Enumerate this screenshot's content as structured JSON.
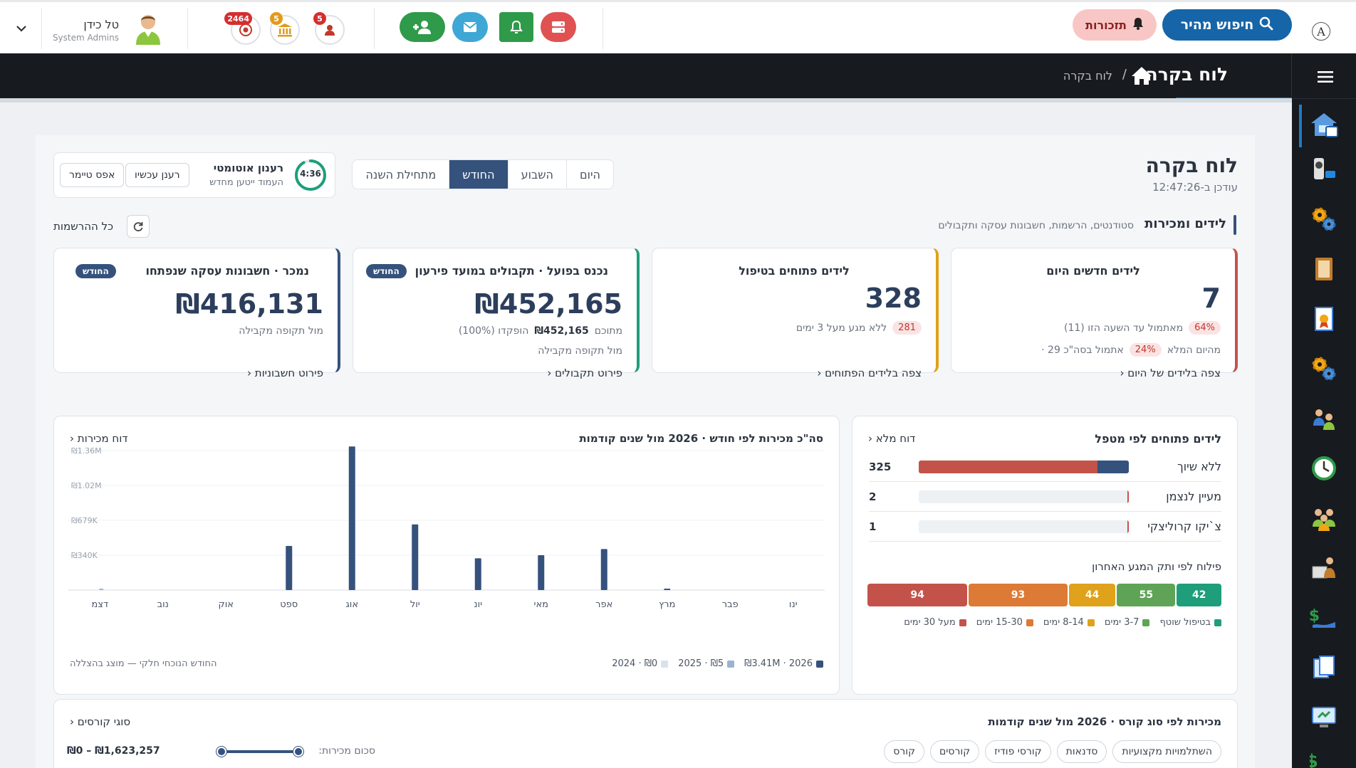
{
  "topbar": {
    "user_name": "טל כידן",
    "user_role": "System Admins",
    "badges": [
      "2464",
      "5",
      "5"
    ],
    "reminders_label": "תזכורות",
    "search_label": "חיפוש מהיר",
    "accessibility_glyph": "A"
  },
  "header": {
    "title": "לוח בקרה",
    "breadcrumb_sep": "/",
    "breadcrumb_current": "לוח בקרה"
  },
  "dashboard": {
    "title": "לוח בקרה",
    "updated": "עודכן ב-12:47:26",
    "tabs": [
      {
        "label": "היום"
      },
      {
        "label": "השבוע"
      },
      {
        "label": "החודש",
        "active": true
      },
      {
        "label": "מתחילת השנה"
      }
    ],
    "auto_refresh_title": "רענון אוטומטי",
    "auto_refresh_sub": "העמוד ייטען מחדש",
    "timer": "4:36",
    "timer_fraction": 0.92,
    "refresh_now": "רענן עכשיו",
    "reset_timer": "אפס טיימר"
  },
  "section": {
    "title": "לידים ומכירות",
    "subtitle": "סטודנטים, הרשמות, חשבונות עסקה ותקבולים",
    "all_registrations": "כל ההרשמות"
  },
  "kpis": {
    "new_leads": {
      "title": "לידים חדשים היום",
      "value": "7",
      "line1_pct": "64%",
      "line1_text": "מאתמול עד השעה הזו (11)",
      "line2_pct": "24%",
      "line2_text_a": "אתמול בסה\"כ 29 ·",
      "line2_text_b": "מהיום המלא",
      "link": "צפה בלידים של היום ‹"
    },
    "open_leads": {
      "title": "לידים פתוחים בטיפול",
      "value": "328",
      "pct": "281",
      "text": "ללא מגע מעל 3 ימים",
      "link": "צפה בלידים הפתוחים ‹"
    },
    "collected": {
      "title": "נכנס בפועל · תקבולים במועד פירעון",
      "badge": "החודש",
      "value": "₪452,165",
      "line1_a": "מתוכם",
      "line1_b": "₪452,165",
      "line1_c": "הופקדו (100%)",
      "line2": "מול תקופה מקבילה",
      "link": "פירוט תקבולים ‹"
    },
    "sold": {
      "title": "נמכר · חשבונות עסקה שנפתחו",
      "badge": "החודש",
      "value": "₪416,131",
      "line": "מול תקופה מקבילה",
      "link": "פירוט חשבוניות ‹"
    }
  },
  "handler_card": {
    "title": "לידים פתוחים לפי מטפל",
    "link": "דוח מלא ‹",
    "rows": [
      {
        "name": "ללא שיוך",
        "count": "325",
        "red": 0.85,
        "blue": 0.15
      },
      {
        "name": "מעיין לנצמן",
        "count": "2",
        "red": 0.005,
        "blue": 0
      },
      {
        "name": "צ`יקו קרוליצקי",
        "count": "1",
        "red": 0.004,
        "blue": 0
      }
    ],
    "dist_title": "פילוח לפי ותק המגע האחרון",
    "segments": [
      {
        "value": "42",
        "color": "#1e9e7a",
        "label": "בטיפול שוטף"
      },
      {
        "value": "55",
        "color": "#5fa356",
        "label": "3-7 ימים"
      },
      {
        "value": "44",
        "color": "#e0a11b",
        "label": "8-14 ימים"
      },
      {
        "value": "93",
        "color": "#dd7a35",
        "label": "15-30 ימים"
      },
      {
        "value": "94",
        "color": "#c3534a",
        "label": "מעל 30 ימים"
      }
    ]
  },
  "sales_chart": {
    "link": "דוח מכירות ‹",
    "legend": [
      "₪3.41M · 2026",
      "₪5 · 2025",
      "₪0 · 2024"
    ],
    "note": "החודש הנוכחי חלקי — מוצג בהצללה",
    "chart_data": {
      "type": "bar",
      "title": "סה\"כ מכירות לפי חודש · 2026 מול שנים קודמות",
      "categories": [
        "ינו",
        "פבר",
        "מרץ",
        "אפר",
        "מאי",
        "יונ",
        "יול",
        "אוג",
        "ספט",
        "אוק",
        "נוב",
        "דצמ"
      ],
      "series": [
        {
          "name": "2026",
          "color": "#35527d",
          "values": [
            0,
            0,
            12000,
            400000,
            340000,
            310000,
            640000,
            1400000,
            430000,
            0,
            0,
            0
          ]
        },
        {
          "name": "2025",
          "color": "#9bb3d1",
          "values": [
            0,
            0,
            0,
            0,
            0,
            0,
            0,
            0,
            0,
            0,
            0,
            5
          ]
        },
        {
          "name": "2024",
          "color": "#d9e1ea",
          "values": [
            0,
            0,
            0,
            0,
            0,
            0,
            0,
            0,
            0,
            0,
            0,
            0
          ]
        }
      ],
      "y_ticks": [
        "₪1.36M",
        "₪1.02M",
        "₪679K",
        "₪340K"
      ],
      "ylim": [
        0,
        1360000
      ],
      "ylabel": "",
      "xlabel": ""
    }
  },
  "course_card": {
    "title": "מכירות לפי סוג קורס · 2026 מול שנים קודמות",
    "link": "סוגי קורסים ‹",
    "chips": [
      "השתלמויות מקצועיות",
      "סדנאות",
      "קורסי פודיז",
      "קורסים",
      "קורס"
    ],
    "range_label": "סכום מכירות:",
    "range_value": "₪0 – ₪1,623,257"
  }
}
